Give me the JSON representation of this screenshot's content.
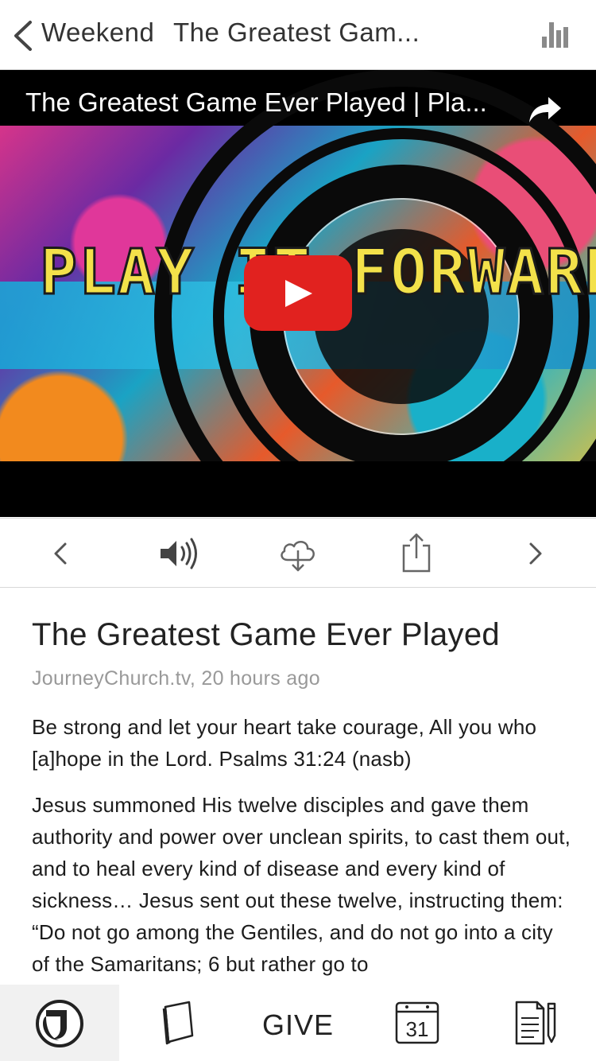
{
  "nav": {
    "back_label": "Weekend",
    "title": "The Greatest Gam..."
  },
  "video": {
    "title": "The Greatest Game Ever Played | Pla...",
    "art_text": "PLAY IT FORWARD",
    "play_color": "#e1221f"
  },
  "controls": {
    "items": [
      "prev-icon",
      "speaker-icon",
      "cloud-download-icon",
      "share-icon",
      "next-icon"
    ]
  },
  "content": {
    "title": "The Greatest Game Ever Played",
    "meta": "JourneyChurch.tv, 20 hours ago",
    "paragraph1": "Be strong and let your heart take courage, All you who [a]hope in the Lord. Psalms 31:24 (nasb)",
    "paragraph2": "Jesus summoned His twelve disciples and gave them authority and power over unclean spirits, to cast them out, and to heal every kind of disease and every kind of sickness… Jesus sent out these twelve, instructing them: “Do not go among the Gentiles, and do not go into a city of the Samaritans; 6 but rather go to"
  },
  "tabbar": {
    "give_label": "GIVE",
    "calendar_day": "31",
    "items": [
      "journey-logo-icon",
      "book-icon",
      "give",
      "calendar-icon",
      "notes-icon"
    ]
  }
}
